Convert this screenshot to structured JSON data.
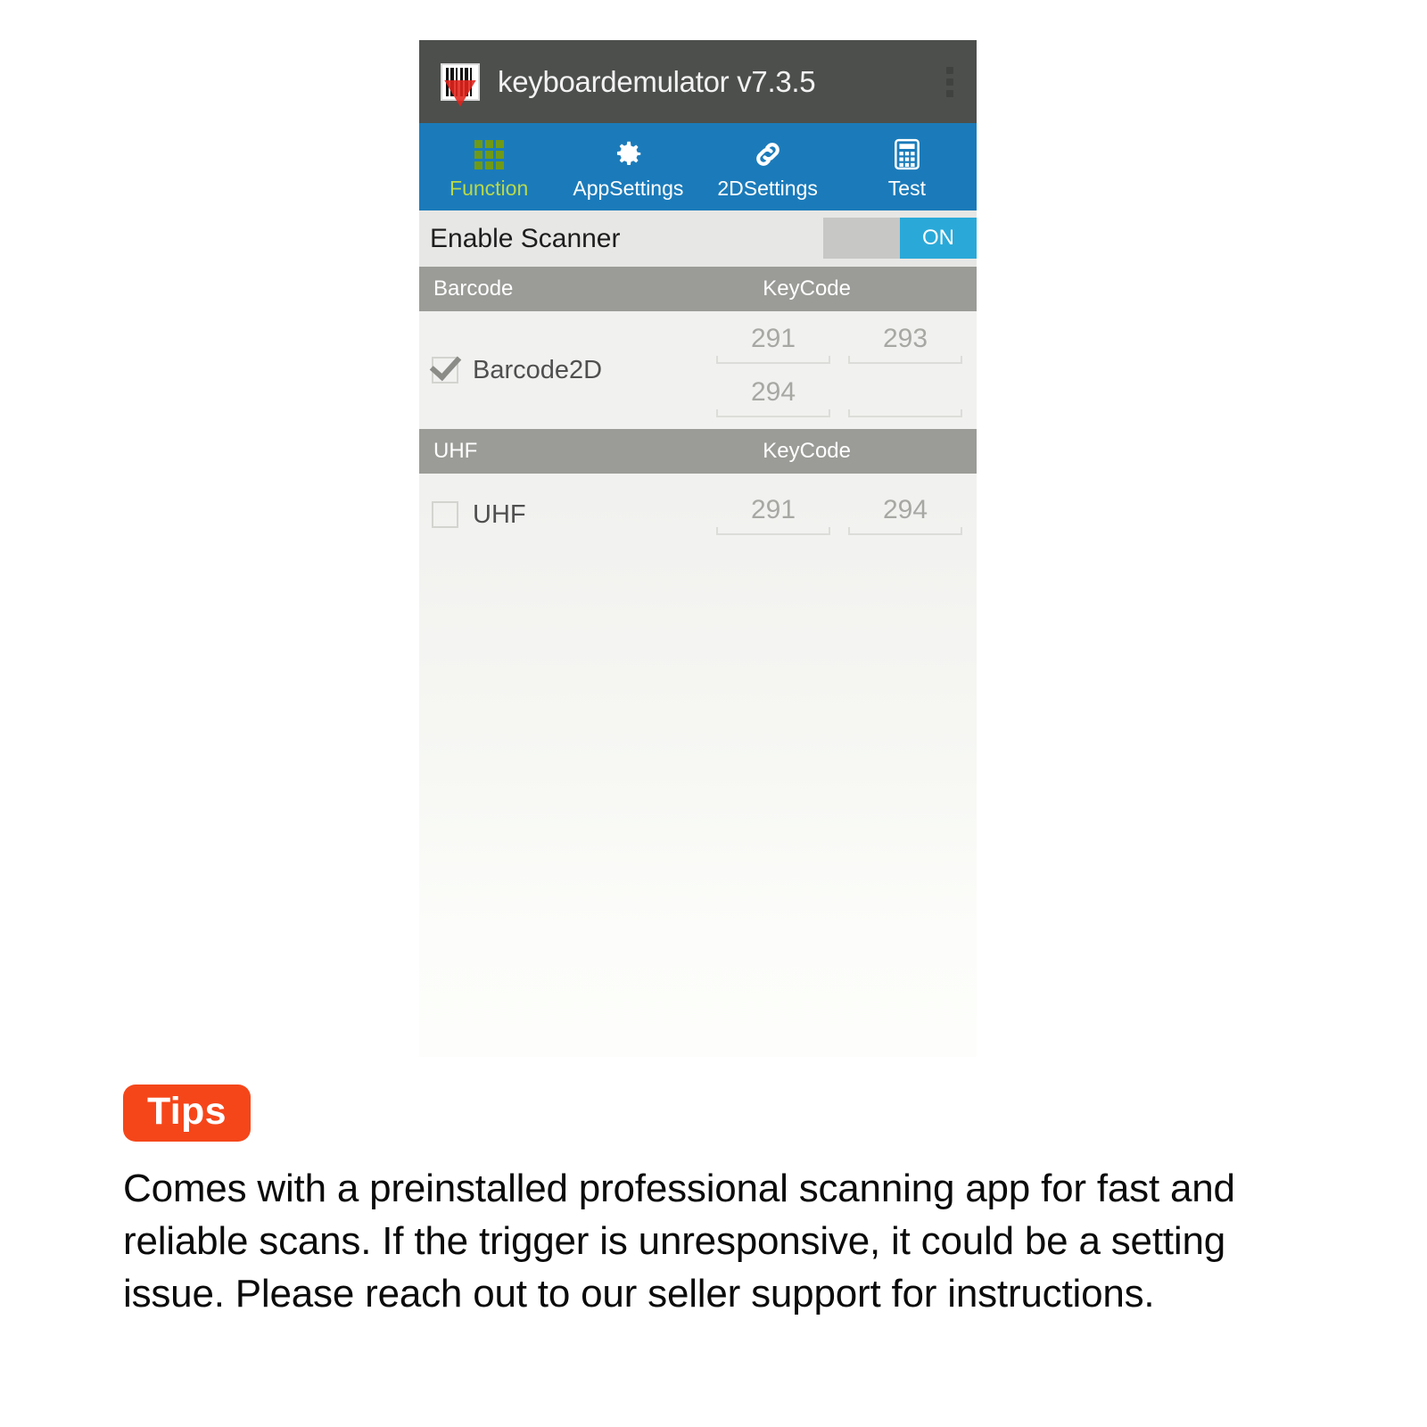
{
  "app": {
    "title": "keyboardemulator v7.3.5",
    "icon": "barcode-scan-icon",
    "overflow": "overflow-menu-icon",
    "tabs": [
      {
        "label": "Function",
        "icon": "grid-icon",
        "active": true
      },
      {
        "label": "AppSettings",
        "icon": "gear-icon",
        "active": false
      },
      {
        "label": "2DSettings",
        "icon": "link-chain-icon",
        "active": false
      },
      {
        "label": "Test",
        "icon": "calculator-icon",
        "active": false
      }
    ],
    "enable_scanner": {
      "label": "Enable Scanner",
      "toggle_state": "ON"
    },
    "sections": [
      {
        "header_left": "Barcode",
        "header_right": "KeyCode",
        "row": {
          "label": "Barcode2D",
          "checked": true,
          "keycodes": [
            "291",
            "293",
            "294",
            ""
          ]
        }
      },
      {
        "header_left": "UHF",
        "header_right": "KeyCode",
        "row": {
          "label": "UHF",
          "checked": false,
          "keycodes": [
            "291",
            "294"
          ]
        }
      }
    ]
  },
  "tips": {
    "badge": "Tips",
    "body": "Comes with a preinstalled professional scanning app for fast and reliable scans. If the trigger is unresponsive, it could be a setting issue. Please reach out to our seller support for instructions."
  },
  "colors": {
    "titlebar": "#4c4f4c",
    "tabbar": "#1b7bba",
    "tab_active_text": "#b9d94a",
    "toggle_on": "#2aa9d8",
    "section_header": "#9b9b97",
    "tips_badge": "#f5461a"
  }
}
